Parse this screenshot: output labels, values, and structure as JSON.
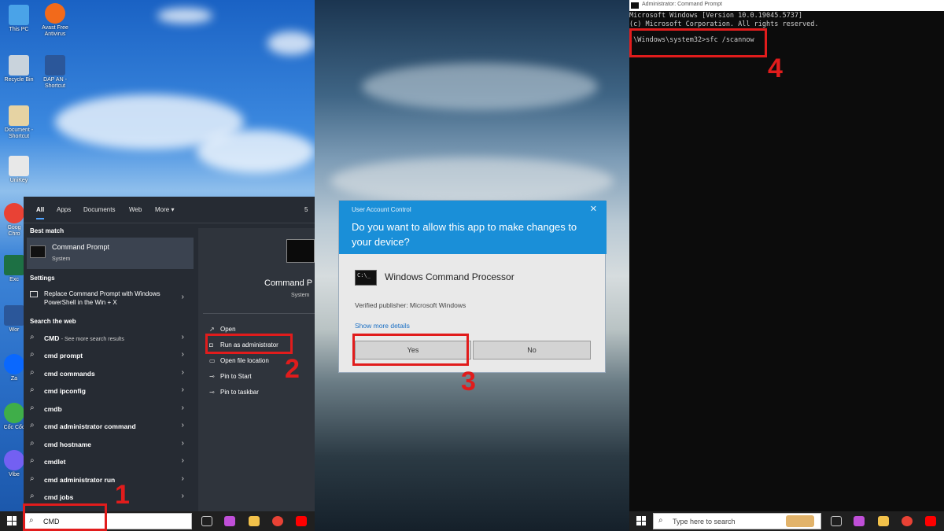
{
  "desktop": {
    "icons": [
      {
        "label": "This PC",
        "icon": "this-pc-icon",
        "color": "#4aa3e8"
      },
      {
        "label": "Avast Free Antivirus",
        "icon": "avast-icon",
        "color": "#f26a1b"
      },
      {
        "label": "Recycle Bin",
        "icon": "recycle-bin-icon",
        "color": "#c9d3dc"
      },
      {
        "label": "DAP AN - Shortcut",
        "icon": "word-doc-icon",
        "color": "#2b579a"
      },
      {
        "label": "Document - Shortcut",
        "icon": "document-icon",
        "color": "#e6d3a3"
      },
      {
        "label": "UniKey",
        "icon": "unikey-icon",
        "color": "#e8e8e8"
      },
      {
        "label": "Goog Chro",
        "icon": "chrome-icon",
        "color": "#e94235"
      },
      {
        "label": "Exc",
        "icon": "excel-icon",
        "color": "#1d7044"
      },
      {
        "label": "Wor",
        "icon": "word-icon",
        "color": "#2b579a"
      },
      {
        "label": "Za",
        "icon": "zalo-icon",
        "color": "#0a68fe"
      },
      {
        "label": "Cốc Cốc",
        "icon": "coccoc-icon",
        "color": "#3fae49"
      },
      {
        "label": "Vibe",
        "icon": "viber-icon",
        "color": "#7360f2"
      }
    ]
  },
  "search_menu": {
    "tabs": [
      "All",
      "Apps",
      "Documents",
      "Web",
      "More ▾"
    ],
    "count": "5",
    "best_match_heading": "Best match",
    "best_match": {
      "title": "Command Prompt",
      "subtitle": "System"
    },
    "settings_heading": "Settings",
    "setting_item": "Replace Command Prompt with Windows PowerShell in the Win + X",
    "web_heading": "Search the web",
    "web_items": [
      {
        "term": "CMD",
        "sub": "- See more search results"
      },
      {
        "term": "cmd prompt",
        "sub": ""
      },
      {
        "term": "cmd commands",
        "sub": ""
      },
      {
        "term": "cmd ipconfig",
        "sub": ""
      },
      {
        "term": "cmdb",
        "sub": ""
      },
      {
        "term": "cmd administrator command",
        "sub": ""
      },
      {
        "term": "cmd hostname",
        "sub": ""
      },
      {
        "term": "cmdlet",
        "sub": ""
      },
      {
        "term": "cmd administrator run",
        "sub": ""
      },
      {
        "term": "cmd jobs",
        "sub": ""
      }
    ],
    "right_pane": {
      "title": "Command P",
      "subtitle": "System",
      "actions": [
        "Open",
        "Run as administrator",
        "Open file location",
        "Pin to Start",
        "Pin to taskbar"
      ]
    }
  },
  "taskbar_left": {
    "search_value": "CMD"
  },
  "taskbar_right": {
    "search_placeholder": "Type here to search"
  },
  "uac": {
    "caption": "User Account Control",
    "close": "✕",
    "question": "Do you want to allow this app to make changes to your device?",
    "app_name": "Windows Command Processor",
    "app_icon_text": "C:\\_",
    "publisher": "Verified publisher: Microsoft Windows",
    "more_details": "Show more details",
    "yes": "Yes",
    "no": "No"
  },
  "console": {
    "title": "Administrator: Command Prompt",
    "lines": [
      "Microsoft Windows [Version 10.0.19045.5737]",
      "(c) Microsoft Corporation. All rights reserved."
    ],
    "command": ":\\Windows\\system32>sfc /scannow"
  },
  "annotations": {
    "step1": "1",
    "step2": "2",
    "step3": "3",
    "step4": "4"
  },
  "colors": {
    "annotation": "#e11c1c",
    "uac_header": "#1a8fd8",
    "menu_bg": "#262b33"
  }
}
